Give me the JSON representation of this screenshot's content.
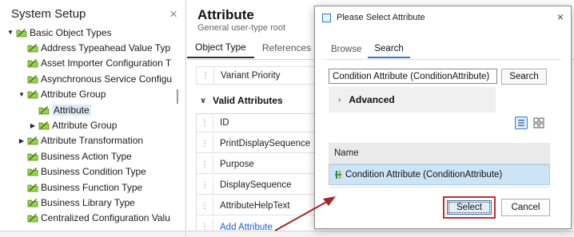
{
  "system_setup": {
    "title": "System Setup",
    "close_icon": "×",
    "tree": [
      {
        "label": "Basic Object Types",
        "indent": 1,
        "expander": "expanded"
      },
      {
        "label": "Address Typeahead Value Typ",
        "indent": 2,
        "expander": "none"
      },
      {
        "label": "Asset Importer Configuration T",
        "indent": 2,
        "expander": "none"
      },
      {
        "label": "Asynchronous Service Configu",
        "indent": 2,
        "expander": "none"
      },
      {
        "label": "Attribute Group",
        "indent": 2,
        "expander": "expanded"
      },
      {
        "label": "Attribute",
        "indent": 3,
        "expander": "none",
        "selected": true
      },
      {
        "label": "Attribute Group",
        "indent": 3,
        "expander": "collapsed"
      },
      {
        "label": "Attribute Transformation",
        "indent": 2,
        "expander": "collapsed"
      },
      {
        "label": "Business Action Type",
        "indent": 2,
        "expander": "none"
      },
      {
        "label": "Business Condition Type",
        "indent": 2,
        "expander": "none"
      },
      {
        "label": "Business Function Type",
        "indent": 2,
        "expander": "none"
      },
      {
        "label": "Business Library Type",
        "indent": 2,
        "expander": "none"
      },
      {
        "label": "Centralized Configuration Valu",
        "indent": 2,
        "expander": "none"
      }
    ]
  },
  "attribute_panel": {
    "title": "Attribute",
    "subtitle": "General user-type root",
    "tabs": [
      {
        "label": "Object Type",
        "active": true
      },
      {
        "label": "References",
        "active": false
      }
    ],
    "variant_priority_label": "Variant Priority",
    "valid_attributes_heading": "Valid Attributes",
    "valid_attributes": [
      "ID",
      "PrintDisplaySequence",
      "Purpose",
      "DisplaySequence",
      "AttributeHelpText"
    ],
    "add_attribute_link": "Add Attribute"
  },
  "dialog": {
    "title": "Please Select Attribute",
    "close_icon": "×",
    "tabs": [
      {
        "label": "Browse",
        "active": false
      },
      {
        "label": "Search",
        "active": true
      }
    ],
    "search_value": "Condition Attribute (ConditionAttribute)",
    "search_button": "Search",
    "advanced_label": "Advanced",
    "results_header": "Name",
    "results": [
      "Condition Attribute (ConditionAttribute)"
    ],
    "select_button": "Select",
    "cancel_button": "Cancel"
  },
  "colors": {
    "selection_highlight": "#cde4f7",
    "tree_selection": "#dde9f5",
    "annotation_red": "#c62c2c",
    "link_blue": "#1f5fc8",
    "accent_blue": "#3777c9"
  }
}
